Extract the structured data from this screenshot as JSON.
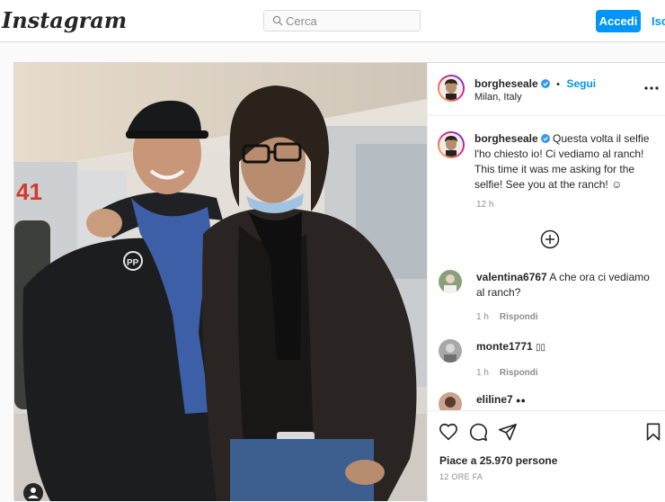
{
  "header": {
    "logo": "Instagram",
    "search_placeholder": "Cerca",
    "login_label": "Accedi",
    "signup_label": "Iscriviti"
  },
  "post": {
    "username": "borgheseale",
    "follow_label": "Segui",
    "location": "Milan, Italy",
    "caption_text": "Questa volta il selfie l'ho chiesto io! Ci vediamo al ranch! This time it was me asking for the selfie! See you at the ranch! ☺",
    "caption_time": "12 h",
    "comments": [
      {
        "username": "valentina6767",
        "text": "A che ora ci vediamo al ranch?",
        "time": "1 h",
        "reply_label": "Rispondi"
      },
      {
        "username": "monte1771",
        "text": "  ",
        "time": "1 h",
        "reply_label": "Rispondi"
      },
      {
        "username": "eliline7",
        "text": "●●"
      }
    ],
    "likes": "Piace a 25.970 persone",
    "age": "12 ORE FA"
  },
  "colors": {
    "accent": "#0095f6",
    "border": "#dbdbdb",
    "muted": "#8e8e8e"
  },
  "icons": [
    "search-icon",
    "verified-icon",
    "more-options-icon",
    "add-circle-icon",
    "heart-icon",
    "comment-icon",
    "share-icon",
    "bookmark-icon",
    "user-tag-icon"
  ]
}
